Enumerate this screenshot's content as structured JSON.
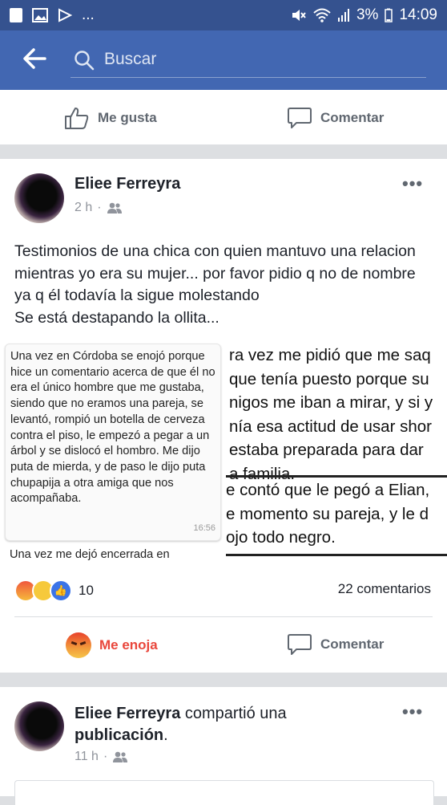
{
  "status_bar": {
    "left_ellipsis": "...",
    "battery_pct": "3%",
    "time": "14:09"
  },
  "search": {
    "placeholder": "Buscar"
  },
  "prev_post_actions": {
    "like": "Me gusta",
    "comment": "Comentar"
  },
  "post": {
    "author": "Eliee Ferreyra",
    "time": "2 h",
    "text": "Testimonios de una chica con quien mantuvo una relacion mientras yo era su mujer... por favor pidio q no de nombre ya q él todavía la sigue molestando\nSe está destapando la ollita...",
    "image_left": {
      "message": "Una vez en Córdoba se enojó porque hice un comentario acerca de que él no era el único hombre que me gustaba, siendo que no eramos una pareja, se levantó, rompió un botella de cerveza contra el piso, le empezó a pegar a un árbol y se dislocó el hombro. Me dijo puta de mierda, y de paso le dijo puta chupapija a otra amiga que nos acompañaba.",
      "message_time": "16:56",
      "next_message": "Una vez me dejó encerrada en"
    },
    "image_right": {
      "para1": [
        "ra vez me pidió que me saq",
        "que tenía puesto porque su",
        "nigos me iban a mirar, y si y",
        "nía esa actitud de usar shor",
        " estaba preparada para dar",
        "a familia."
      ],
      "para2": [
        "e contó que le pegó a Elian,",
        "e momento su pareja, y le d",
        "ojo todo negro."
      ]
    },
    "reaction_count": "10",
    "comments_count": "22 comentarios",
    "actions": {
      "react": "Me enoja",
      "comment": "Comentar"
    }
  },
  "next_post": {
    "author": "Eliee Ferreyra",
    "action": " compartió una",
    "action_object": "publicación",
    "time": "11 h"
  },
  "colors": {
    "header": "#4267b2",
    "statusbar": "#35528f",
    "angry_red": "#e9463b"
  }
}
